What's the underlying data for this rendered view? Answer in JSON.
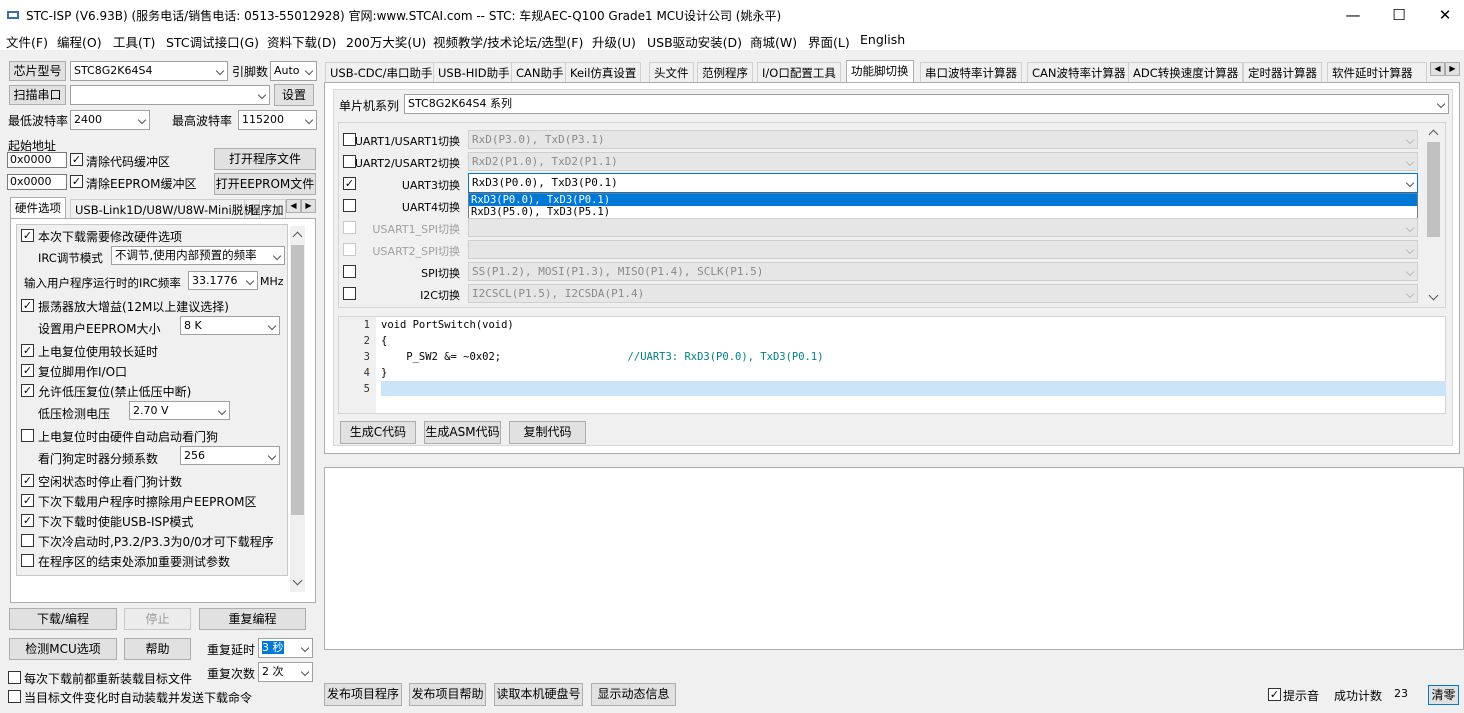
{
  "window": {
    "title": "STC-ISP (V6.93B) (服务电话/销售电话: 0513-55012928) 官网:www.STCAI.com  -- STC: 车规AEC-Q100 Grade1 MCU设计公司 (姚永平)",
    "minimize": "—",
    "maximize": "☐",
    "close": "✕"
  },
  "menu": [
    "文件(F)",
    "编程(O)",
    "工具(T)",
    "STC调试接口(G)",
    "资料下载(D)",
    "200万大奖(U)",
    "视频教学/技术论坛/选型(F)",
    "升级(U)",
    "USB驱动安装(D)",
    "商城(W)",
    "界面(L)",
    "English"
  ],
  "left": {
    "chip_label": "芯片型号",
    "chip_value": "STC8G2K64S4",
    "pins_label": "引脚数",
    "pins_value": "Auto",
    "scan_port": "扫描串口",
    "port_value": "",
    "settings": "设置",
    "min_baud_label": "最低波特率",
    "min_baud_value": "2400",
    "max_baud_label": "最高波特率",
    "max_baud_value": "115200",
    "start_addr_label": "起始地址",
    "addr1": "0x0000",
    "clear_code": "清除代码缓冲区",
    "open_prog": "打开程序文件",
    "addr2": "0x0000",
    "clear_eeprom": "清除EEPROM缓冲区",
    "open_eeprom": "打开EEPROM文件",
    "tabs": [
      "硬件选项",
      "USB-Link1D/U8W/U8W-Mini脱机",
      "程序加"
    ],
    "hw": {
      "opt1": "本次下载需要修改硬件选项",
      "irc_mode_label": "IRC调节模式",
      "irc_mode_value": "不调节,使用内部预置的频率",
      "irc_freq_label": "输入用户程序运行时的IRC频率",
      "irc_freq_value": "33.1776",
      "mhz": "MHz",
      "osc_gain": "振荡器放大增益(12M以上建议选择)",
      "eeprom_size_label": "设置用户EEPROM大小",
      "eeprom_size_value": "8   K",
      "por_delay": "上电复位使用较长延时",
      "reset_io": "复位脚用作I/O口",
      "lvr": "允许低压复位(禁止低压中断)",
      "lvd_label": "低压检测电压",
      "lvd_value": "2.70 V",
      "wdt_auto": "上电复位时由硬件自动启动看门狗",
      "wdt_div_label": "看门狗定时器分频系数",
      "wdt_div_value": "256",
      "idle_wdt": "空闲状态时停止看门狗计数",
      "erase_eeprom": "下次下载用户程序时擦除用户EEPROM区",
      "usb_isp": "下次下载时使能USB-ISP模式",
      "p32p33": "下次冷启动时,P3.2/P3.3为0/0才可下载程序",
      "add_test": "在程序区的结束处添加重要测试参数"
    },
    "download": "下载/编程",
    "stop": "停止",
    "reprogram": "重复编程",
    "detect": "检测MCU选项",
    "help": "帮助",
    "repeat_delay_label": "重复延时",
    "repeat_delay_value": "3 秒",
    "repeat_count_label": "重复次数",
    "repeat_count_value": "2 次",
    "reload_each": "每次下载前都重新装载目标文件",
    "auto_send": "当目标文件变化时自动装载并发送下载命令"
  },
  "tabs": [
    "USB-CDC/串口助手",
    "USB-HID助手",
    "CAN助手",
    "Keil仿真设置",
    "头文件",
    "范例程序",
    "I/O口配置工具",
    "功能脚切换",
    "串口波特率计算器",
    "CAN波特率计算器",
    "ADC转换速度计算器",
    "定时器计算器",
    "软件延时计算器"
  ],
  "pinswitch": {
    "series_label": "单片机系列",
    "series_value": "STC8G2K64S4 系列",
    "rows": [
      {
        "label": "UART1/USART1切换",
        "value": "RxD(P3.0), TxD(P3.1)",
        "checked": "",
        "enabled": true
      },
      {
        "label": "UART2/USART2切换",
        "value": "RxD2(P1.0), TxD2(P1.1)",
        "checked": "",
        "enabled": true
      },
      {
        "label": "UART3切换",
        "value": "RxD3(P0.0), TxD3(P0.1)",
        "checked": "✓",
        "enabled": true
      },
      {
        "label": "UART4切换",
        "value": "",
        "checked": "",
        "enabled": true
      },
      {
        "label": "USART1_SPI切换",
        "value": "",
        "checked": "",
        "enabled": false
      },
      {
        "label": "USART2_SPI切换",
        "value": "",
        "checked": "",
        "enabled": false
      },
      {
        "label": "SPI切换",
        "value": "SS(P1.2), MOSI(P1.3), MISO(P1.4), SCLK(P1.5)",
        "checked": "",
        "enabled": true
      },
      {
        "label": "I2C切换",
        "value": "I2CSCL(P1.5), I2CSDA(P1.4)",
        "checked": "",
        "enabled": true
      }
    ],
    "dropdown_options": [
      "RxD3(P0.0), TxD3(P0.1)",
      "RxD3(P5.0), TxD3(P5.1)"
    ],
    "code_lines": [
      "void PortSwitch(void)",
      "{",
      "    P_SW2 &= ~0x02;                    //UART3: RxD3(P0.0), TxD3(P0.1)",
      "}",
      ""
    ],
    "line_numbers": [
      "1",
      "2",
      "3",
      "4",
      "5"
    ],
    "gen_c": "生成C代码",
    "gen_asm": "生成ASM代码",
    "copy_code": "复制代码"
  },
  "bottom": {
    "publish_prog": "发布项目程序",
    "publish_help": "发布项目帮助",
    "read_disk": "读取本机硬盘号",
    "show_dynamic": "显示动态信息",
    "beep": "提示音",
    "success_label": "成功计数",
    "success_value": "23",
    "clear": "清零"
  },
  "colors": {
    "selection": "#0078d7",
    "highlight_row": "#cce4f7",
    "code_comment": "#008080"
  }
}
